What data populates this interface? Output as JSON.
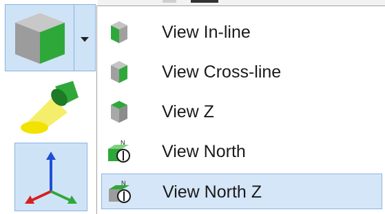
{
  "menu": {
    "items": [
      {
        "label": "View In-line",
        "icon": "cube-inline-icon"
      },
      {
        "label": "View Cross-line",
        "icon": "cube-crossline-icon"
      },
      {
        "label": "View Z",
        "icon": "cube-top-icon"
      },
      {
        "label": "View North",
        "icon": "north-compass-icon"
      },
      {
        "label": "View North Z",
        "icon": "north-compass-z-icon",
        "selected": true
      }
    ]
  },
  "toolbar": {
    "view_button_icon": "cube-view-icon",
    "light_button_icon": "spotlight-icon",
    "axis_button_icon": "axes-icon"
  },
  "colors": {
    "cube_green": "#2fa83a",
    "cube_gray": "#a8a8a8",
    "selection_bg": "#d5e6f8",
    "selection_border": "#8cb4e0"
  }
}
